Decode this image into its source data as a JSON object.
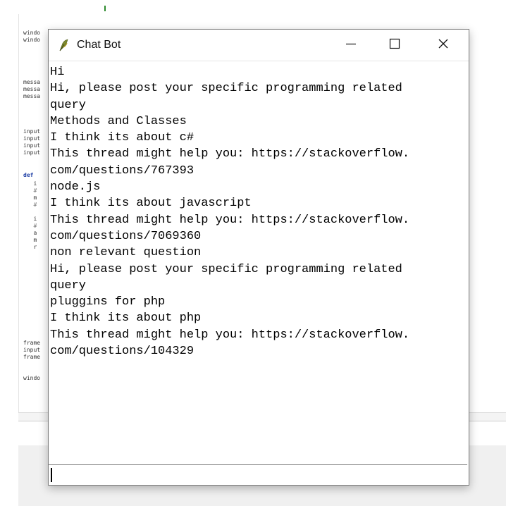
{
  "background_editor": {
    "code_lines": [
      {
        "text": "windo",
        "style": ""
      },
      {
        "text": "windo",
        "style": ""
      },
      {
        "text": "messa",
        "style": ""
      },
      {
        "text": "messa",
        "style": ""
      },
      {
        "text": "messa",
        "style": ""
      },
      {
        "text": "input",
        "style": ""
      },
      {
        "text": "input",
        "style": ""
      },
      {
        "text": "input",
        "style": ""
      },
      {
        "text": "input",
        "style": ""
      },
      {
        "text": "def",
        "style": "kw"
      },
      {
        "text": "   i",
        "style": ""
      },
      {
        "text": "   #",
        "style": "cm"
      },
      {
        "text": "   m",
        "style": ""
      },
      {
        "text": "   #",
        "style": "cm"
      },
      {
        "text": "   i",
        "style": ""
      },
      {
        "text": "   #",
        "style": "cm"
      },
      {
        "text": "   a",
        "style": ""
      },
      {
        "text": "   m",
        "style": ""
      },
      {
        "text": "   r",
        "style": ""
      },
      {
        "text": "frame",
        "style": ""
      },
      {
        "text": "input",
        "style": ""
      },
      {
        "text": "frame",
        "style": ""
      },
      {
        "text": "windo",
        "style": ""
      }
    ]
  },
  "chat_window": {
    "title": "Chat Bot",
    "icon": "feather-icon",
    "controls": [
      "minimize-icon",
      "maximize-icon",
      "close-icon"
    ],
    "messages": [
      "Hi",
      "Hi, please post your specific programming related",
      "query",
      "Methods and Classes",
      "I think its about c#",
      "This thread might help you: https://stackoverflow.",
      "com/questions/767393",
      "node.js",
      "I think its about javascript",
      "This thread might help you: https://stackoverflow.",
      "com/questions/7069360",
      "non relevant question",
      "Hi, please post your specific programming related",
      "query",
      "pluggins for php",
      "I think its about php",
      "This thread might help you: https://stackoverflow.",
      "com/questions/104329"
    ],
    "input_value": ""
  }
}
